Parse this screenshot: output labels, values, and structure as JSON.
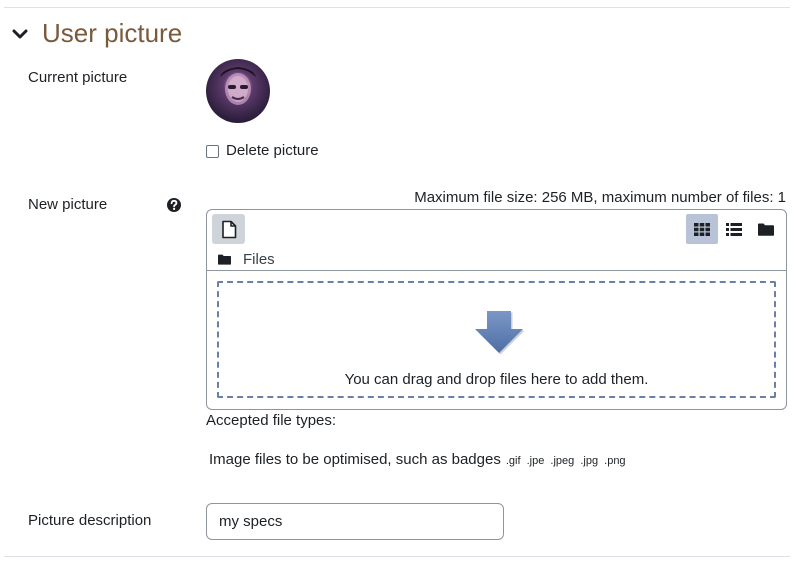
{
  "section": {
    "title": "User picture"
  },
  "current_picture": {
    "label": "Current picture",
    "delete_label": "Delete picture"
  },
  "new_picture": {
    "label": "New picture",
    "max_info": "Maximum file size: 256 MB, maximum number of files: 1",
    "path_label": "Files",
    "drop_text": "You can drag and drop files here to add them.",
    "accepted_label": "Accepted file types:",
    "types_description": "Image files to be optimised, such as badges",
    "extensions": [
      ".gif",
      ".jpe",
      ".jpeg",
      ".jpg",
      ".png"
    ],
    "icons": {
      "add_file": "file-icon",
      "view_icons": "grid-icon",
      "view_list": "list-icon",
      "view_tree": "folder-icon",
      "path_folder": "folder-icon",
      "drop_arrow": "arrow-down-icon",
      "help": "question-circle-icon"
    }
  },
  "picture_description": {
    "label": "Picture description",
    "value": "my specs"
  },
  "colors": {
    "section_title": "#7a5a3d",
    "active_view": "#b8c3d8",
    "dropzone_border": "#6b80a6",
    "arrow": "#5a7bb0"
  }
}
